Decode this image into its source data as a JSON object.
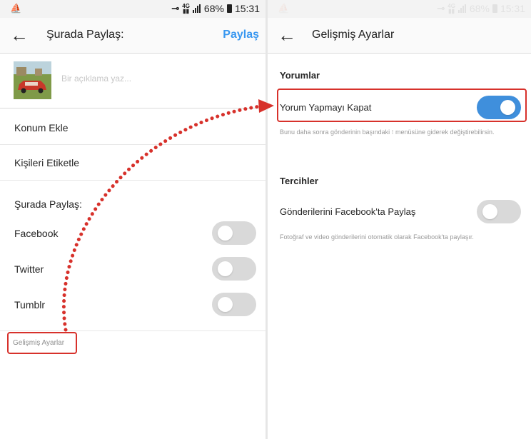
{
  "left": {
    "status": {
      "battery": "68%",
      "time": "15:31"
    },
    "header": {
      "title": "Şurada Paylaş:",
      "share_label": "Paylaş"
    },
    "caption": {
      "placeholder": "Bir açıklama yaz..."
    },
    "rows": {
      "location": "Konum Ekle",
      "tag_people": "Kişileri Etiketle"
    },
    "share_section": {
      "heading": "Şurada Paylaş:",
      "networks": [
        {
          "name": "Facebook",
          "enabled": false
        },
        {
          "name": "Twitter",
          "enabled": false
        },
        {
          "name": "Tumblr",
          "enabled": false
        }
      ]
    },
    "advanced_link": "Gelişmiş Ayarlar"
  },
  "right": {
    "status": {
      "battery": "68%",
      "time": "15:31"
    },
    "header": {
      "title": "Gelişmiş Ayarlar"
    },
    "comments": {
      "heading": "Yorumlar",
      "label": "Yorum Yapmayı Kapat",
      "enabled": true,
      "helper": "Bunu daha sonra gönderinin başındaki ⁝ menüsüne giderek değiştirebilirsin."
    },
    "preferences": {
      "heading": "Tercihler",
      "label": "Gönderilerini Facebook'ta Paylaş",
      "enabled": false,
      "helper": "Fotoğraf ve video gönderilerini otomatik olarak Facebook'ta paylaşır."
    }
  },
  "colors": {
    "accent": "#3897f0",
    "toggle_on": "#3f8fdc",
    "highlight": "#d7312b"
  }
}
